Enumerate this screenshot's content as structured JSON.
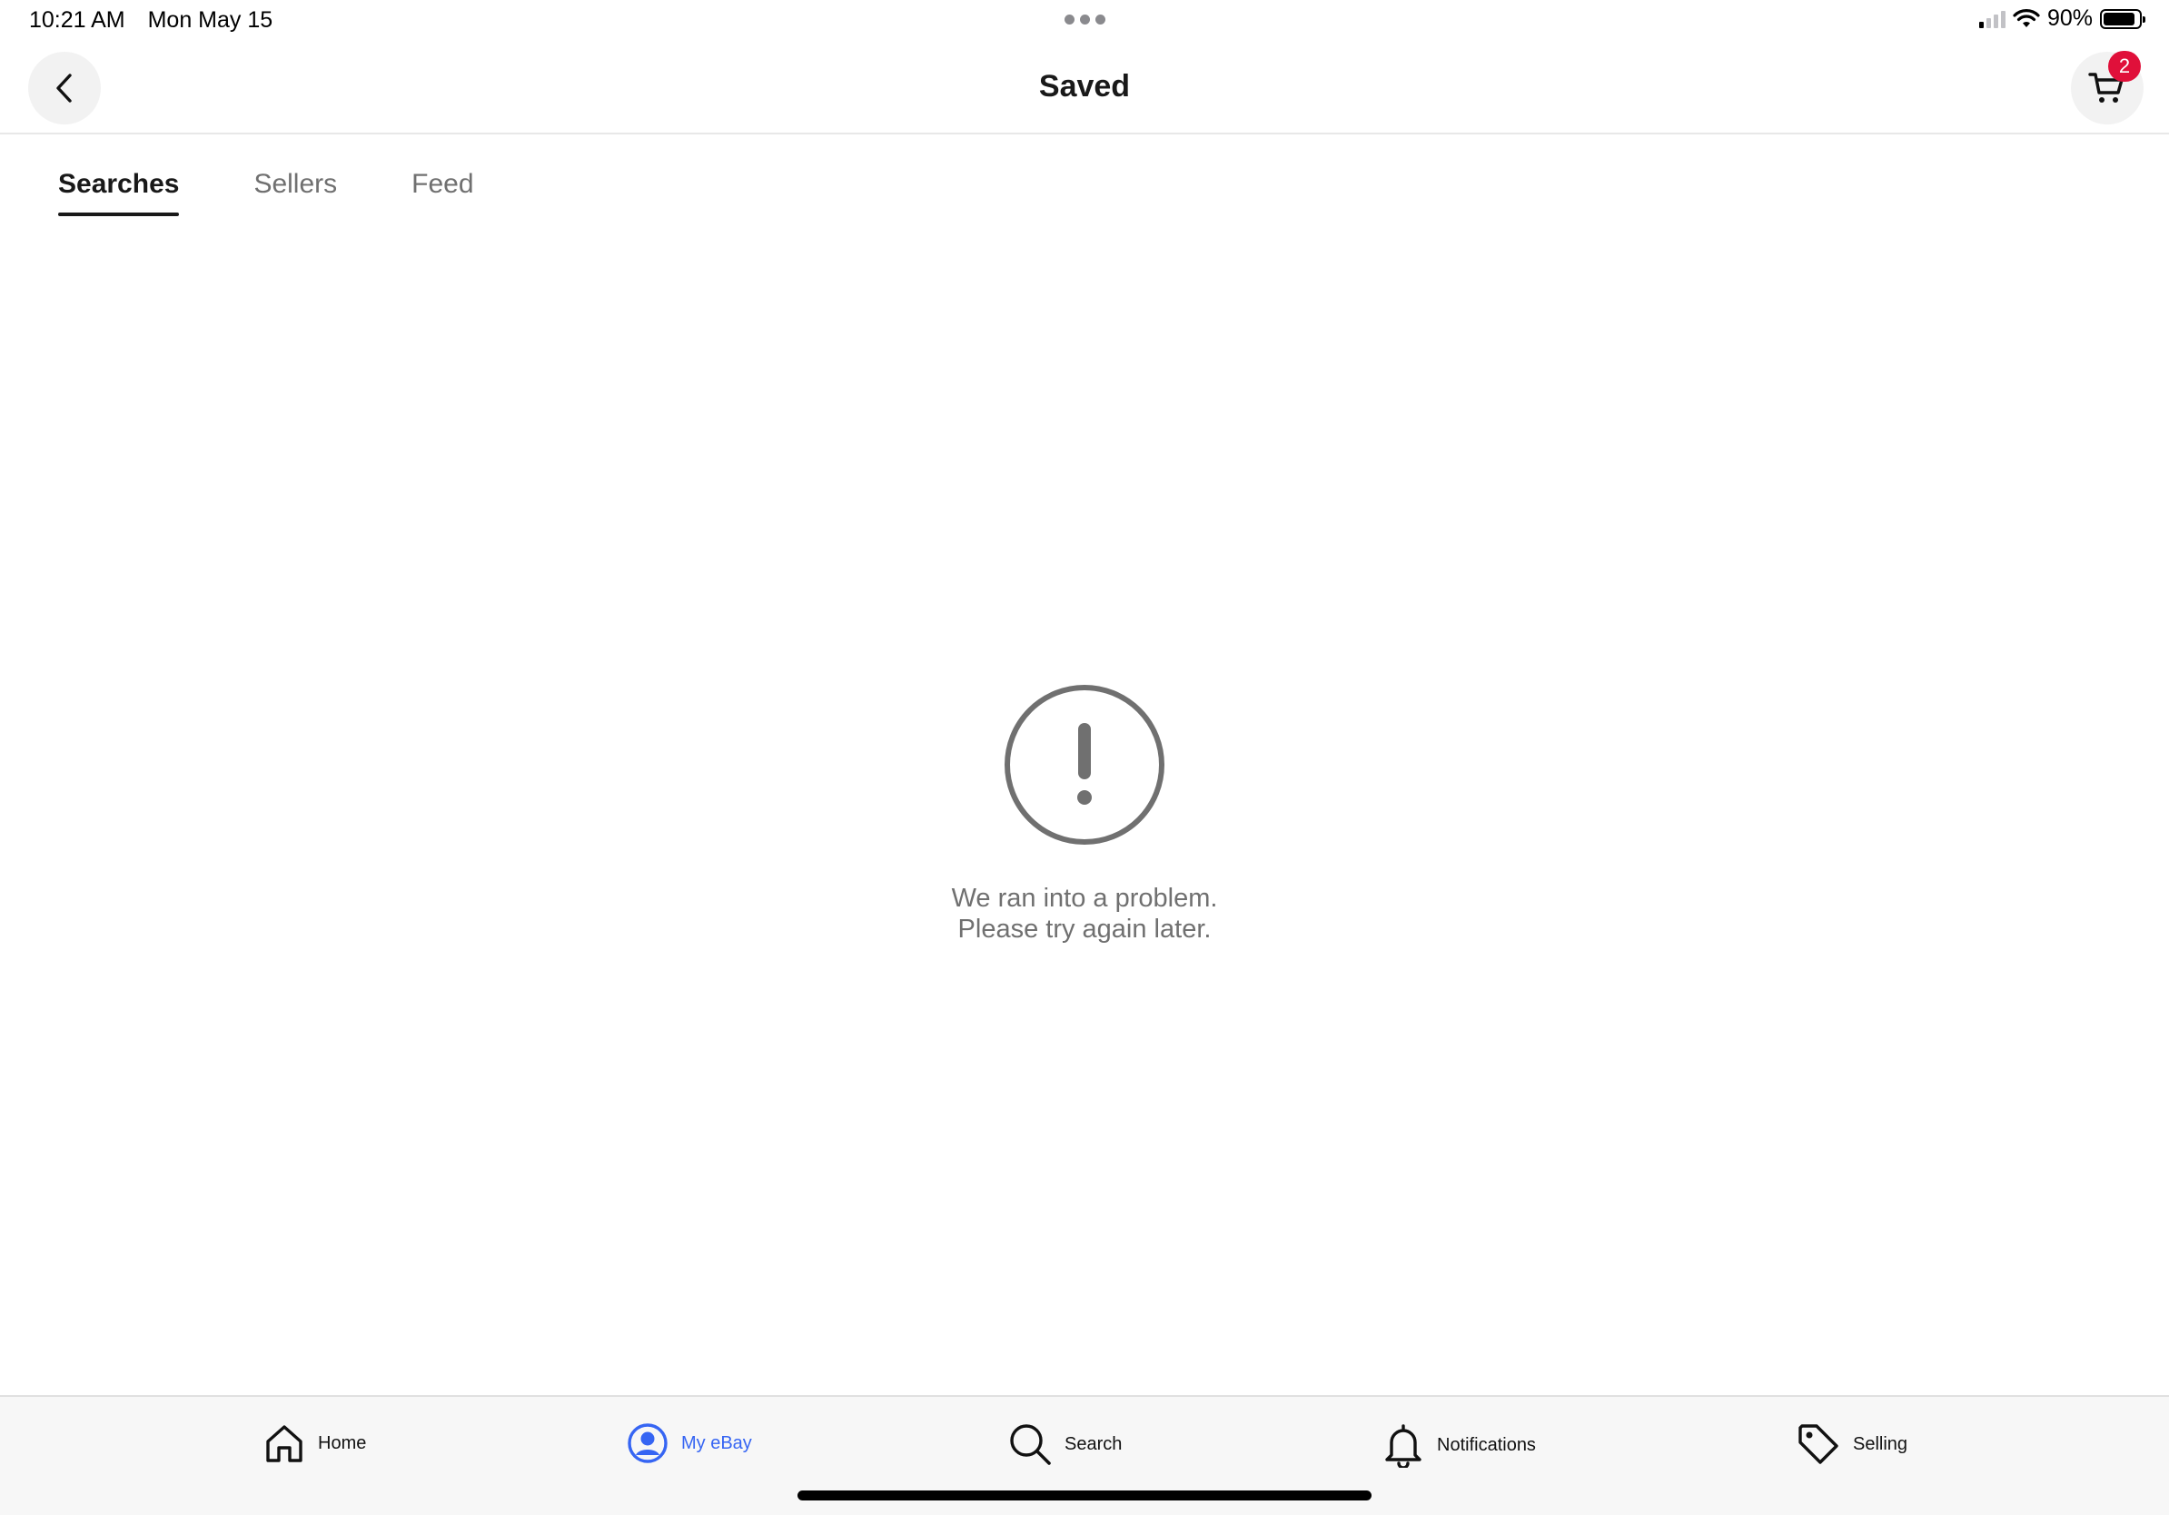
{
  "status_bar": {
    "time": "10:21 AM",
    "date": "Mon May 15",
    "battery": "90%"
  },
  "header": {
    "title": "Saved",
    "cart_count": "2"
  },
  "tabs": [
    {
      "label": "Searches",
      "active": true
    },
    {
      "label": "Sellers",
      "active": false
    },
    {
      "label": "Feed",
      "active": false
    }
  ],
  "error": {
    "line1": "We ran into a problem.",
    "line2": "Please try again later."
  },
  "bottom_nav": {
    "items": [
      {
        "label": "Home",
        "icon": "home-icon"
      },
      {
        "label": "My eBay",
        "icon": "user-icon",
        "active": true
      },
      {
        "label": "Search",
        "icon": "search-icon"
      },
      {
        "label": "Notifications",
        "icon": "bell-icon"
      },
      {
        "label": "Selling",
        "icon": "tag-icon"
      }
    ]
  },
  "colors": {
    "accent": "#3665f3",
    "badge": "#e0103a",
    "muted_text": "#707070"
  }
}
